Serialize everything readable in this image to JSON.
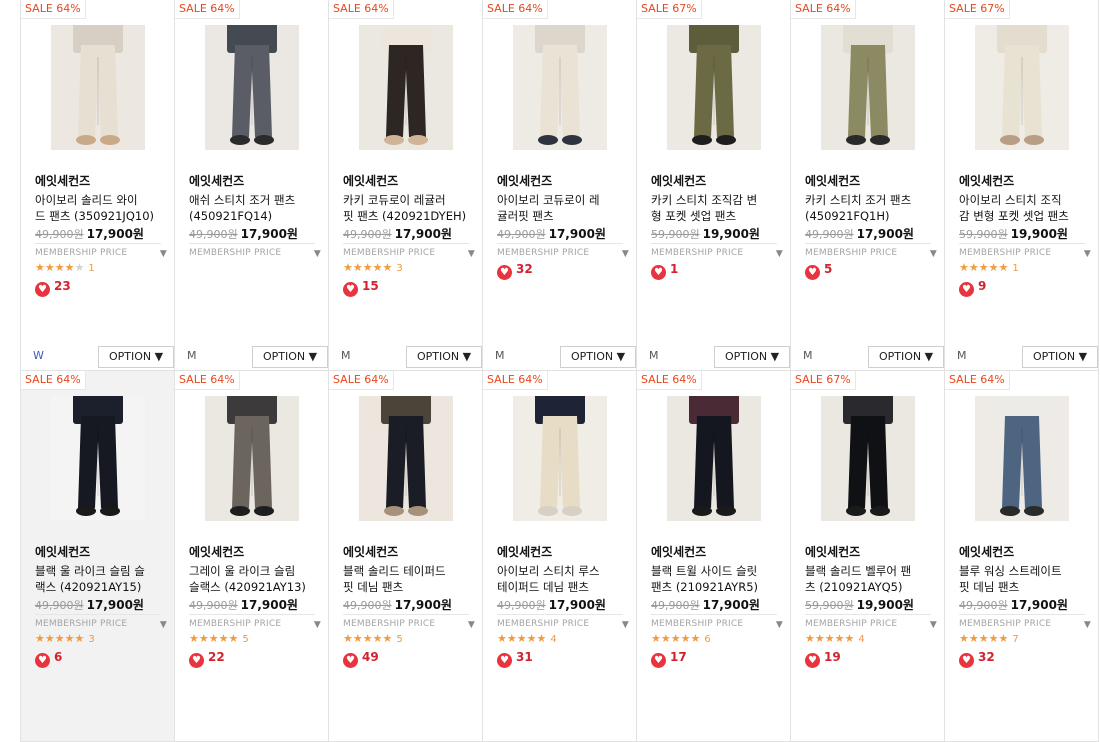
{
  "products": [
    {
      "sale": "SALE 64%",
      "brand": "에잇세컨즈",
      "name1": "아이보리 솔리드 와이",
      "name2": "드 팬츠 (350921JQ10)",
      "old": "49,900원",
      "price": "17,900원",
      "member": "MEMBERSHIP PRICE",
      "rating": 4,
      "reviews": "1",
      "likes": "23",
      "size": "W",
      "option": "OPTION ▼",
      "pants": "#e6dfd2",
      "top": "#d7cfc4",
      "bg": "#ece7e0",
      "shoes": "#caa98a"
    },
    {
      "sale": "SALE 64%",
      "brand": "에잇세컨즈",
      "name1": "애쉬 스티치 조거 팬츠",
      "name2": "(450921FQ14)",
      "old": "49,900원",
      "price": "17,900원",
      "member": "MEMBERSHIP PRICE",
      "rating": 0,
      "reviews": "",
      "likes": "",
      "size": "M",
      "option": "OPTION ▼",
      "pants": "#5b5d66",
      "top": "#444a52",
      "bg": "#ebe8e4",
      "shoes": "#2b2b2b"
    },
    {
      "sale": "SALE 64%",
      "brand": "에잇세컨즈",
      "name1": "카키 코듀로이 레귤러",
      "name2": "핏 팬츠 (420921DYEH)",
      "old": "49,900원",
      "price": "17,900원",
      "member": "MEMBERSHIP PRICE",
      "rating": 5,
      "reviews": "3",
      "likes": "15",
      "size": "M",
      "option": "OPTION ▼",
      "pants": "#2e2622",
      "top": "#ece6dc",
      "bg": "#ebe7e1",
      "shoes": "#cfb497"
    },
    {
      "sale": "SALE 64%",
      "brand": "에잇세컨즈",
      "name1": "아이보리 코듀로이 레",
      "name2": "귤러핏 팬츠",
      "old": "49,900원",
      "price": "17,900원",
      "member": "MEMBERSHIP PRICE",
      "rating": 0,
      "reviews": "",
      "likes": "32",
      "size": "M",
      "option": "OPTION ▼",
      "pants": "#e9e2d5",
      "top": "#dcd6cc",
      "bg": "#eeeae4",
      "shoes": "#2d3440"
    },
    {
      "sale": "SALE 67%",
      "brand": "에잇세컨즈",
      "name1": "카키 스티치 조직감 변",
      "name2": "형 포켓 셋업 팬츠",
      "old": "59,900원",
      "price": "19,900원",
      "member": "MEMBERSHIP PRICE",
      "rating": 0,
      "reviews": "",
      "likes": "1",
      "size": "M",
      "option": "OPTION ▼",
      "pants": "#6b6a44",
      "top": "#5e5d3b",
      "bg": "#ece8e2",
      "shoes": "#1e1e1e"
    },
    {
      "sale": "SALE 64%",
      "brand": "에잇세컨즈",
      "name1": "카키 스티치 조거 팬츠",
      "name2": "(450921FQ1H)",
      "old": "49,900원",
      "price": "17,900원",
      "member": "MEMBERSHIP PRICE",
      "rating": 0,
      "reviews": "",
      "likes": "5",
      "size": "M",
      "option": "OPTION ▼",
      "pants": "#8c8a63",
      "top": "#e3ded3",
      "bg": "#ebe7e1",
      "shoes": "#2a2a2a"
    },
    {
      "sale": "SALE 67%",
      "brand": "에잇세컨즈",
      "name1": "아이보리 스티치 조직",
      "name2": "감 변형 포켓 셋업 팬츠",
      "old": "59,900원",
      "price": "19,900원",
      "member": "MEMBERSHIP PRICE",
      "rating": 5,
      "reviews": "1",
      "likes": "9",
      "size": "M",
      "option": "OPTION ▼",
      "pants": "#e8e2d3",
      "top": "#e4ddcf",
      "bg": "#efebe5",
      "shoes": "#b89e84"
    },
    {
      "sale": "SALE 64%",
      "brand": "에잇세컨즈",
      "name1": "블랙 울 라이크 슬림 슬",
      "name2": "랙스 (420921AY15)",
      "old": "49,900원",
      "price": "17,900원",
      "member": "MEMBERSHIP PRICE",
      "rating": 5,
      "reviews": "3",
      "likes": "6",
      "size": "",
      "option": "",
      "pants": "#161822",
      "top": "#1c1f2c",
      "bg": "#f4f4f4",
      "shoes": "#1a1a1a",
      "hover": true
    },
    {
      "sale": "SALE 64%",
      "brand": "에잇세컨즈",
      "name1": "그레이 울 라이크 슬림",
      "name2": "슬랙스 (420921AY13)",
      "old": "49,900원",
      "price": "17,900원",
      "member": "MEMBERSHIP PRICE",
      "rating": 5,
      "reviews": "5",
      "likes": "22",
      "size": "",
      "option": "",
      "pants": "#6b655e",
      "top": "#3c3a3a",
      "bg": "#ebe7e1",
      "shoes": "#1e1e1e"
    },
    {
      "sale": "SALE 64%",
      "brand": "에잇세컨즈",
      "name1": "블랙 솔리드 테이퍼드",
      "name2": "핏 데님 팬츠",
      "old": "49,900원",
      "price": "17,900원",
      "member": "MEMBERSHIP PRICE",
      "rating": 4.5,
      "reviews": "5",
      "likes": "49",
      "size": "",
      "option": "",
      "pants": "#1a1d26",
      "top": "#4a4538",
      "bg": "#ece6de",
      "shoes": "#a8917b"
    },
    {
      "sale": "SALE 64%",
      "brand": "에잇세컨즈",
      "name1": "아이보리 스티치 루스",
      "name2": "테이퍼드 데님 팬츠",
      "old": "49,900원",
      "price": "17,900원",
      "member": "MEMBERSHIP PRICE",
      "rating": 4.5,
      "reviews": "4",
      "likes": "31",
      "size": "",
      "option": "",
      "pants": "#e7dcc5",
      "top": "#1f2336",
      "bg": "#f0ece6",
      "shoes": "#d8d0c4"
    },
    {
      "sale": "SALE 64%",
      "brand": "에잇세컨즈",
      "name1": "블랙 트윌 사이드 슬릿",
      "name2": "팬츠 (210921AYR5)",
      "old": "49,900원",
      "price": "17,900원",
      "member": "MEMBERSHIP PRICE",
      "rating": 5,
      "reviews": "6",
      "likes": "17",
      "size": "",
      "option": "",
      "pants": "#141720",
      "top": "#4a2a34",
      "bg": "#ebe7e1",
      "shoes": "#1a1a1a"
    },
    {
      "sale": "SALE 67%",
      "brand": "에잇세컨즈",
      "name1": "블랙 솔리드 벨루어 팬",
      "name2": "츠 (210921AYQ5)",
      "old": "59,900원",
      "price": "19,900원",
      "member": "MEMBERSHIP PRICE",
      "rating": 4.5,
      "reviews": "4",
      "likes": "19",
      "size": "",
      "option": "",
      "pants": "#101114",
      "top": "#2a2a2e",
      "bg": "#ebe7e1",
      "shoes": "#1a1a1a"
    },
    {
      "sale": "SALE 64%",
      "brand": "에잇세컨즈",
      "name1": "블루 워싱 스트레이트",
      "name2": "핏 데님 팬츠",
      "old": "49,900원",
      "price": "17,900원",
      "member": "MEMBERSHIP PRICE",
      "rating": 5,
      "reviews": "7",
      "likes": "32",
      "size": "",
      "option": "",
      "pants": "#4d6580",
      "top": "#ecebe8",
      "bg": "#eeebe6",
      "shoes": "#2a2a2a"
    }
  ],
  "icons": {
    "heart": "heart-icon",
    "star": "star-icon",
    "caret": "chevron-down-icon"
  }
}
